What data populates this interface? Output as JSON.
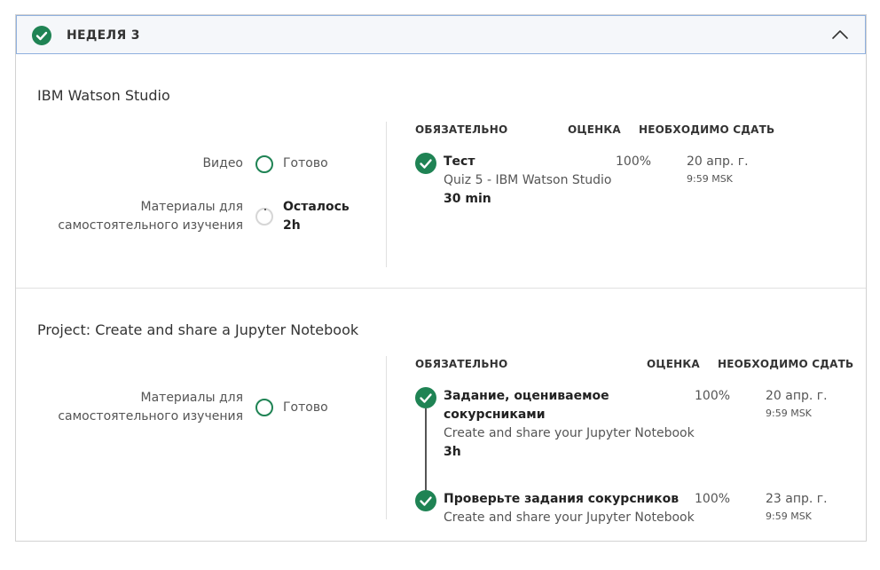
{
  "week": {
    "title": "НЕДЕЛЯ 3"
  },
  "colors": {
    "accent": "#1f8354",
    "header_border": "#8fb0de"
  },
  "sections": [
    {
      "title": "IBM Watson Studio",
      "materials": [
        {
          "label": "Видео",
          "status": "Готово",
          "icon": "ring-complete-icon"
        },
        {
          "label_line1": "Материалы для",
          "label_line2": "самостоятельного изучения",
          "status_line1": "Осталось",
          "status_line2": "2h",
          "icon": "ring-progress-icon"
        }
      ],
      "columns": {
        "required": "ОБЯЗАТЕЛЬНО",
        "grade": "ОЦЕНКА",
        "due": "НЕОБХОДИМО СДАТЬ"
      },
      "items": [
        {
          "type": "Тест",
          "name": "Quiz 5 - IBM Watson Studio",
          "duration": "30 min",
          "grade": "100%",
          "date": "20 апр. г.",
          "time": "9:59 MSK"
        }
      ]
    },
    {
      "title": "Project: Create and share a Jupyter Notebook",
      "materials": [
        {
          "label_line1": "Материалы для",
          "label_line2": "самостоятельного изучения",
          "status": "Готово",
          "icon": "ring-complete-icon"
        }
      ],
      "columns": {
        "required": "ОБЯЗАТЕЛЬНО",
        "grade": "ОЦЕНКА",
        "due": "НЕОБХОДИМО СДАТЬ"
      },
      "items": [
        {
          "type_line1": "Задание, оцениваемое",
          "type_line2": "сокурсниками",
          "name": "Create and share your Jupyter Notebook",
          "duration": "3h",
          "grade": "100%",
          "date": "20 апр. г.",
          "time": "9:59 MSK"
        },
        {
          "type": "Проверьте задания сокурсников",
          "name": "Create and share your Jupyter Notebook",
          "grade": "100%",
          "date": "23 апр. г.",
          "time": "9:59 MSK"
        }
      ]
    }
  ]
}
